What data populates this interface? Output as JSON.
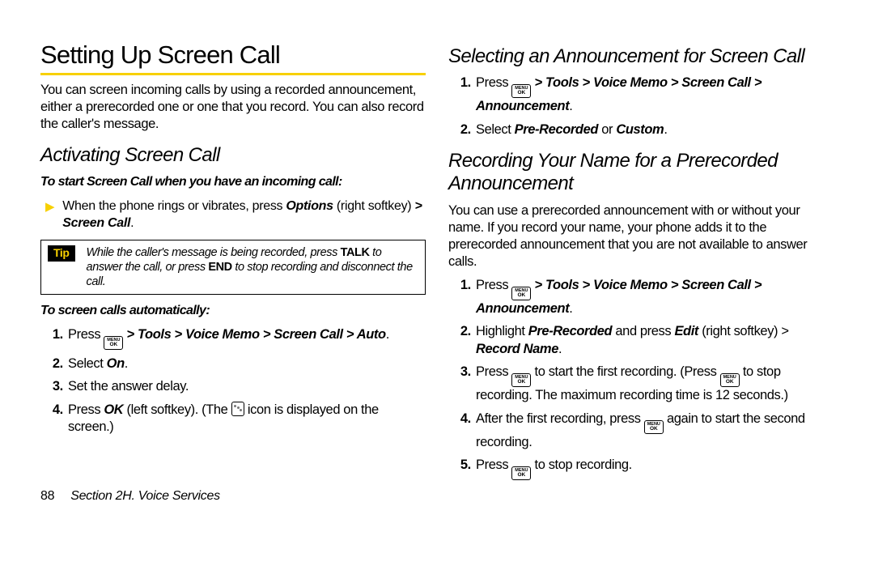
{
  "left": {
    "h1": "Setting Up Screen Call",
    "intro": "You can screen incoming calls by using a recorded announcement, either a prerecorded one or one that you record. You can also record the caller's message.",
    "h2a": "Activating Screen Call",
    "lead1": "To start Screen Call when you have an incoming call:",
    "tri_a": "When the phone rings or vibrates, press ",
    "tri_b": "Options",
    "tri_c": " (right softkey) ",
    "tri_gt": ">",
    "tri_d": " Screen Call",
    "tip_label": "Tip",
    "tip_a": "While the caller's message is being recorded, press ",
    "tip_talk": "TALK",
    "tip_b": " to answer the call, or press ",
    "tip_end": "END",
    "tip_c": " to stop recording and disconnect the call.",
    "lead2": "To screen calls automatically:",
    "ol": {
      "s1a": "Press ",
      "s1b": " > Tools > Voice Memo > Screen Call > Auto",
      "s2a": "Select ",
      "s2b": "On",
      "s3": "Set the answer delay.",
      "s4a": "Press ",
      "s4b": "OK",
      "s4c": " (left softkey). (The ",
      "s4d": " icon is displayed on the screen.)"
    }
  },
  "right": {
    "h2a": "Selecting an Announcement for Screen Call",
    "ol1": {
      "s1a": "Press ",
      "s1b": " > Tools > Voice Memo > Screen Call > Announcement",
      "s2a": "Select ",
      "s2b": "Pre-Recorded",
      "s2c": " or ",
      "s2d": "Custom"
    },
    "h2b": "Recording Your Name for a Prerecorded Announcement",
    "intro": "You can use a prerecorded announcement with or without your name. If you record your name, your phone adds it to the prerecorded announcement that you are not available to answer calls.",
    "ol2": {
      "s1a": "Press ",
      "s1b": " > Tools > Voice Memo > Screen Call > Announcement",
      "s2a": "Highlight ",
      "s2b": "Pre-Recorded",
      "s2c": " and press ",
      "s2d": "Edit",
      "s2e": " (right softkey) > ",
      "s2f": "Record Name",
      "s3a": "Press ",
      "s3b": " to start the first recording. (Press ",
      "s3c": " to stop recording. The maximum recording time is 12 seconds.)",
      "s4a": "After the first recording, press ",
      "s4b": " again to start the second recording.",
      "s5a": "Press ",
      "s5b": " to stop recording."
    }
  },
  "key": {
    "top": "MENU",
    "bot": "OK"
  },
  "footer": {
    "page": "88",
    "section": "Section 2H. Voice Services"
  }
}
